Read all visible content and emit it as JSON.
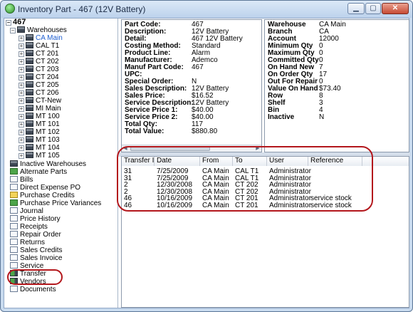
{
  "window": {
    "title": "Inventory Part - 467 (12V Battery)",
    "buttons": [
      "▁",
      "▢",
      "✕"
    ]
  },
  "tree": {
    "root": "467",
    "warehouses_label": "Warehouses",
    "warehouses": [
      "CA Main",
      "CAL T1",
      "CT 201",
      "CT 202",
      "CT 203",
      "CT 204",
      "CT 205",
      "CT 206",
      "CT-New",
      "MI Main",
      "MT 100",
      "MT 101",
      "MT 102",
      "MT 103",
      "MT 104",
      "MT 105"
    ],
    "selected_warehouse": "CA Main",
    "items": [
      "Inactive Warehouses",
      "Alternate Parts",
      "Bills",
      "Direct Expense PO",
      "Purchase Credits",
      "Purchase Price Variances",
      "Journal",
      "Price History",
      "Receipts",
      "Repair Order",
      "Returns",
      "Sales Credits",
      "Sales Invoice",
      "Service",
      "Transfer",
      "Vendors",
      "Documents"
    ],
    "selected_item": "Transfer"
  },
  "part_info": {
    "rows": [
      {
        "label": "Part Code:",
        "value": "467"
      },
      {
        "label": "Description:",
        "value": "12V Battery"
      },
      {
        "label": "Detail:",
        "value": "467 12V Battery"
      },
      {
        "label": "Costing Method:",
        "value": "Standard"
      },
      {
        "label": "Product Line:",
        "value": "Alarm"
      },
      {
        "label": "Manufacturer:",
        "value": "Ademco"
      },
      {
        "label": "Manuf Part Code:",
        "value": "467"
      },
      {
        "label": "UPC:",
        "value": ""
      },
      {
        "label": "Special Order:",
        "value": "N"
      },
      {
        "label": "Sales Description:",
        "value": "12V Battery"
      },
      {
        "label": "Sales Price:",
        "value": "$16.52"
      },
      {
        "label": "Service Description:",
        "value": "12V Battery"
      },
      {
        "label": "Service Price 1:",
        "value": "$40.00"
      },
      {
        "label": "Service Price 2:",
        "value": "$40.00"
      },
      {
        "label": "Total Qty:",
        "value": "117"
      },
      {
        "label": "Total Value:",
        "value": "$880.80"
      }
    ]
  },
  "warehouse_info": {
    "rows": [
      {
        "label": "Warehouse",
        "value": "CA Main"
      },
      {
        "label": "Branch",
        "value": "CA"
      },
      {
        "label": "Account",
        "value": "12000"
      },
      {
        "label": "Minimum Qty",
        "value": "0"
      },
      {
        "label": "Maximum Qty",
        "value": "0"
      },
      {
        "label": "Committed Qty",
        "value": "0"
      },
      {
        "label": "On Hand New",
        "value": "7"
      },
      {
        "label": "On Order Qty",
        "value": "17"
      },
      {
        "label": "Out For Repair",
        "value": "0"
      },
      {
        "label": "Value On Hand",
        "value": "$73.40"
      },
      {
        "label": "Row",
        "value": "8"
      },
      {
        "label": "Shelf",
        "value": "3"
      },
      {
        "label": "Bin",
        "value": "4"
      },
      {
        "label": "Inactive",
        "value": "N"
      }
    ]
  },
  "transfers": {
    "columns": [
      "Transfer ID",
      "Date",
      "From",
      "To",
      "User",
      "Reference"
    ],
    "rows": [
      [
        "31",
        "7/25/2009",
        "CA Main",
        "CAL T1",
        "Administrator",
        ""
      ],
      [
        "31",
        "7/25/2009",
        "CA Main",
        "CAL T1",
        "Administrator",
        ""
      ],
      [
        "2",
        "12/30/2008",
        "CA Main",
        "CT 202",
        "Administrator",
        ""
      ],
      [
        "2",
        "12/30/2008",
        "CA Main",
        "CT 202",
        "Administrator",
        ""
      ],
      [
        "46",
        "10/16/2009",
        "CA Main",
        "CT 201",
        "Administrator",
        "service stock"
      ],
      [
        "46",
        "10/16/2009",
        "CA Main",
        "CT 201",
        "Administrator",
        "service stock"
      ]
    ]
  },
  "colors": {
    "annotation": "#b3171c",
    "selected_text": "#1f5fd0"
  }
}
